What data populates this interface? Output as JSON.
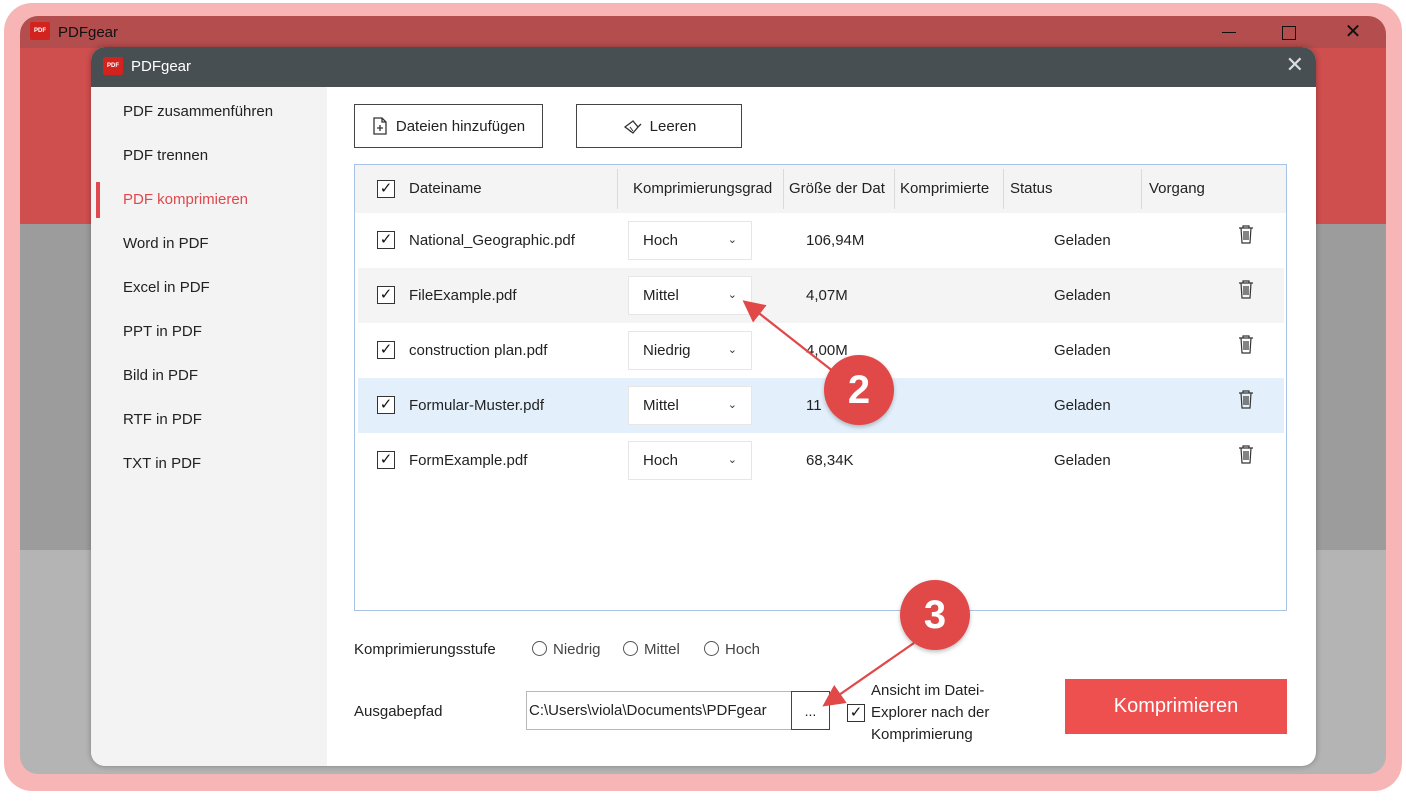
{
  "main_window": {
    "title": "PDFgear",
    "controls": {
      "minimize": "minimize",
      "maximize": "maximize",
      "close": "✕"
    }
  },
  "dialog": {
    "title": "PDFgear",
    "close": "✕"
  },
  "sidebar": {
    "items": [
      {
        "label": "PDF zusammenführen",
        "active": false
      },
      {
        "label": "PDF trennen",
        "active": false
      },
      {
        "label": "PDF komprimieren",
        "active": true
      },
      {
        "label": "Word in PDF",
        "active": false
      },
      {
        "label": "Excel in PDF",
        "active": false
      },
      {
        "label": "PPT in PDF",
        "active": false
      },
      {
        "label": "Bild in PDF",
        "active": false
      },
      {
        "label": "RTF in PDF",
        "active": false
      },
      {
        "label": "TXT in PDF",
        "active": false
      }
    ]
  },
  "toolbar": {
    "add_files": "Dateien hinzufügen",
    "clear": "Leeren"
  },
  "table": {
    "headers": {
      "filename": "Dateiname",
      "level": "Komprimierungsgrad",
      "size": "Größe der Dat",
      "compressed": "Komprimierte",
      "status": "Status",
      "action": "Vorgang"
    },
    "rows": [
      {
        "checked": true,
        "name": "National_Geographic.pdf",
        "level": "Hoch",
        "size": "106,94M",
        "status": "Geladen"
      },
      {
        "checked": true,
        "name": "FileExample.pdf",
        "level": "Mittel",
        "size": "4,07M",
        "status": "Geladen"
      },
      {
        "checked": true,
        "name": "construction plan.pdf",
        "level": "Niedrig",
        "size": "4,00M",
        "status": "Geladen"
      },
      {
        "checked": true,
        "name": "Formular-Muster.pdf",
        "level": "Mittel",
        "size": "11",
        "status": "Geladen"
      },
      {
        "checked": true,
        "name": "FormExample.pdf",
        "level": "Hoch",
        "size": "68,34K",
        "status": "Geladen"
      }
    ]
  },
  "compression_level": {
    "label": "Komprimierungsstufe",
    "options": [
      "Niedrig",
      "Mittel",
      "Hoch"
    ]
  },
  "output": {
    "label": "Ausgabepfad",
    "path": "C:\\Users\\viola\\Documents\\PDFgear",
    "browse": "...",
    "explorer_checked": true,
    "explorer_label": "Ansicht im Datei-Explorer nach der Komprimierung"
  },
  "compress_button": "Komprimieren",
  "annotations": {
    "badge2": "2",
    "badge3": "3",
    "color": "#e14848"
  }
}
